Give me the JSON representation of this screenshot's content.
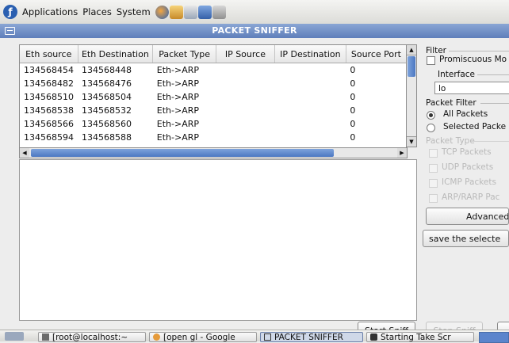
{
  "top_panel": {
    "menus": [
      "Applications",
      "Places",
      "System"
    ],
    "launcher_icons": [
      "web-browser-icon",
      "mail-icon",
      "notes-icon",
      "office-icon",
      "calculator-icon"
    ]
  },
  "window": {
    "title": "PACKET SNIFFER"
  },
  "packet_table": {
    "columns": [
      "Eth source",
      "Eth Destination",
      "Packet Type",
      "IP Source",
      "IP Destination",
      "Source Port"
    ],
    "rows": [
      [
        "134568454",
        "134568448",
        "Eth->ARP",
        "",
        "",
        "0"
      ],
      [
        "134568482",
        "134568476",
        "Eth->ARP",
        "",
        "",
        "0"
      ],
      [
        "134568510",
        "134568504",
        "Eth->ARP",
        "",
        "",
        "0"
      ],
      [
        "134568538",
        "134568532",
        "Eth->ARP",
        "",
        "",
        "0"
      ],
      [
        "134568566",
        "134568560",
        "Eth->ARP",
        "",
        "",
        "0"
      ],
      [
        "134568594",
        "134568588",
        "Eth->ARP",
        "",
        "",
        "0"
      ]
    ]
  },
  "filter_panel": {
    "filter_label": "Filter",
    "promiscuous_label": "Promiscuous Mo",
    "interface_label": "Interface",
    "interface_value": "lo",
    "packet_filter_label": "Packet Filter",
    "all_packets_label": "All Packets",
    "selected_packets_label": "Selected Packe",
    "packet_type_label": "Packet Type",
    "types": [
      "TCP Packets",
      "UDP Packets",
      "ICMP Packets",
      "ARP/RARP Pac"
    ],
    "advanced_label": "Advanced",
    "save_label": "save the selecte"
  },
  "buttons": {
    "start": "Start Sniff",
    "stop": "Stop Sniff"
  },
  "taskbar": {
    "tasks": [
      "[root@localhost:~",
      "[open gl - Google",
      "PACKET SNIFFER",
      "Starting Take Scr"
    ]
  },
  "colors": {
    "title_bar": "#6f8ec6",
    "selection_blue": "#5a83c9"
  }
}
